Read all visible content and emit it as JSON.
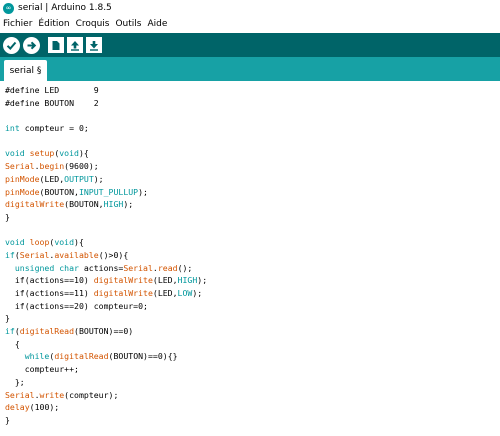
{
  "window": {
    "title": "serial | Arduino 1.8.5",
    "app_icon": "arduino-logo-icon"
  },
  "menubar": {
    "items": [
      "Fichier",
      "Édition",
      "Croquis",
      "Outils",
      "Aide"
    ]
  },
  "toolbar": {
    "buttons": [
      {
        "name": "verify-button",
        "icon": "check-icon"
      },
      {
        "name": "upload-button",
        "icon": "arrow-right-icon"
      },
      {
        "name": "new-button",
        "icon": "new-file-icon"
      },
      {
        "name": "open-button",
        "icon": "arrow-up-icon"
      },
      {
        "name": "save-button",
        "icon": "arrow-down-icon"
      }
    ],
    "colors": {
      "toolbar_bg": "#006468",
      "tabbar_bg": "#17a1a5"
    }
  },
  "tabs": [
    {
      "label": "serial §",
      "active": true
    }
  ],
  "colors": {
    "keyword": "#00979c",
    "function": "#d35400",
    "constant": "#00979c",
    "text": "#000000"
  },
  "editor": {
    "lines": [
      [
        {
          "t": "#define LED       9",
          "c": "plain"
        }
      ],
      [
        {
          "t": "#define BOUTON    2",
          "c": "plain"
        }
      ],
      [],
      [
        {
          "t": "int",
          "c": "kw"
        },
        {
          "t": " compteur = 0;",
          "c": "plain"
        }
      ],
      [],
      [
        {
          "t": "void",
          "c": "kw"
        },
        {
          "t": " ",
          "c": "plain"
        },
        {
          "t": "setup",
          "c": "fn"
        },
        {
          "t": "(",
          "c": "plain"
        },
        {
          "t": "void",
          "c": "kw"
        },
        {
          "t": "){",
          "c": "plain"
        }
      ],
      [
        {
          "t": "Serial",
          "c": "fn"
        },
        {
          "t": ".",
          "c": "plain"
        },
        {
          "t": "begin",
          "c": "fn"
        },
        {
          "t": "(9600);",
          "c": "plain"
        }
      ],
      [
        {
          "t": "pinMode",
          "c": "fn"
        },
        {
          "t": "(LED,",
          "c": "plain"
        },
        {
          "t": "OUTPUT",
          "c": "const"
        },
        {
          "t": ");",
          "c": "plain"
        }
      ],
      [
        {
          "t": "pinMode",
          "c": "fn"
        },
        {
          "t": "(BOUTON,",
          "c": "plain"
        },
        {
          "t": "INPUT_PULLUP",
          "c": "const"
        },
        {
          "t": ");",
          "c": "plain"
        }
      ],
      [
        {
          "t": "digitalWrite",
          "c": "fn"
        },
        {
          "t": "(BOUTON,",
          "c": "plain"
        },
        {
          "t": "HIGH",
          "c": "const"
        },
        {
          "t": ");",
          "c": "plain"
        }
      ],
      [
        {
          "t": "}",
          "c": "plain"
        }
      ],
      [],
      [
        {
          "t": "void",
          "c": "kw"
        },
        {
          "t": " ",
          "c": "plain"
        },
        {
          "t": "loop",
          "c": "fn"
        },
        {
          "t": "(",
          "c": "plain"
        },
        {
          "t": "void",
          "c": "kw"
        },
        {
          "t": "){",
          "c": "plain"
        }
      ],
      [
        {
          "t": "if",
          "c": "kw"
        },
        {
          "t": "(",
          "c": "plain"
        },
        {
          "t": "Serial",
          "c": "fn"
        },
        {
          "t": ".",
          "c": "plain"
        },
        {
          "t": "available",
          "c": "fn"
        },
        {
          "t": "()>0){",
          "c": "plain"
        }
      ],
      [
        {
          "t": "  ",
          "c": "plain"
        },
        {
          "t": "unsigned",
          "c": "kw"
        },
        {
          "t": " ",
          "c": "plain"
        },
        {
          "t": "char",
          "c": "kw"
        },
        {
          "t": " actions=",
          "c": "plain"
        },
        {
          "t": "Serial",
          "c": "fn"
        },
        {
          "t": ".",
          "c": "plain"
        },
        {
          "t": "read",
          "c": "fn"
        },
        {
          "t": "();",
          "c": "plain"
        }
      ],
      [
        {
          "t": "  if(actions==10) ",
          "c": "plain"
        },
        {
          "t": "digitalWrite",
          "c": "fn"
        },
        {
          "t": "(LED,",
          "c": "plain"
        },
        {
          "t": "HIGH",
          "c": "const"
        },
        {
          "t": ");",
          "c": "plain"
        }
      ],
      [
        {
          "t": "  if(actions==11) ",
          "c": "plain"
        },
        {
          "t": "digitalWrite",
          "c": "fn"
        },
        {
          "t": "(LED,",
          "c": "plain"
        },
        {
          "t": "LOW",
          "c": "const"
        },
        {
          "t": ");",
          "c": "plain"
        }
      ],
      [
        {
          "t": "  if(actions==20) compteur=0;",
          "c": "plain"
        }
      ],
      [
        {
          "t": "}",
          "c": "plain"
        }
      ],
      [
        {
          "t": "if",
          "c": "kw"
        },
        {
          "t": "(",
          "c": "plain"
        },
        {
          "t": "digitalRead",
          "c": "fn"
        },
        {
          "t": "(BOUTON)==0)",
          "c": "plain"
        }
      ],
      [
        {
          "t": "  {",
          "c": "plain"
        }
      ],
      [
        {
          "t": "    ",
          "c": "plain"
        },
        {
          "t": "while",
          "c": "kw"
        },
        {
          "t": "(",
          "c": "plain"
        },
        {
          "t": "digitalRead",
          "c": "fn"
        },
        {
          "t": "(BOUTON)==0){}",
          "c": "plain"
        }
      ],
      [
        {
          "t": "    compteur++;",
          "c": "plain"
        }
      ],
      [
        {
          "t": "  };",
          "c": "plain"
        }
      ],
      [
        {
          "t": "Serial",
          "c": "fn"
        },
        {
          "t": ".",
          "c": "plain"
        },
        {
          "t": "write",
          "c": "fn"
        },
        {
          "t": "(compteur);",
          "c": "plain"
        }
      ],
      [
        {
          "t": "delay",
          "c": "fn"
        },
        {
          "t": "(100);",
          "c": "plain"
        }
      ],
      [
        {
          "t": "}",
          "c": "plain"
        }
      ]
    ]
  }
}
